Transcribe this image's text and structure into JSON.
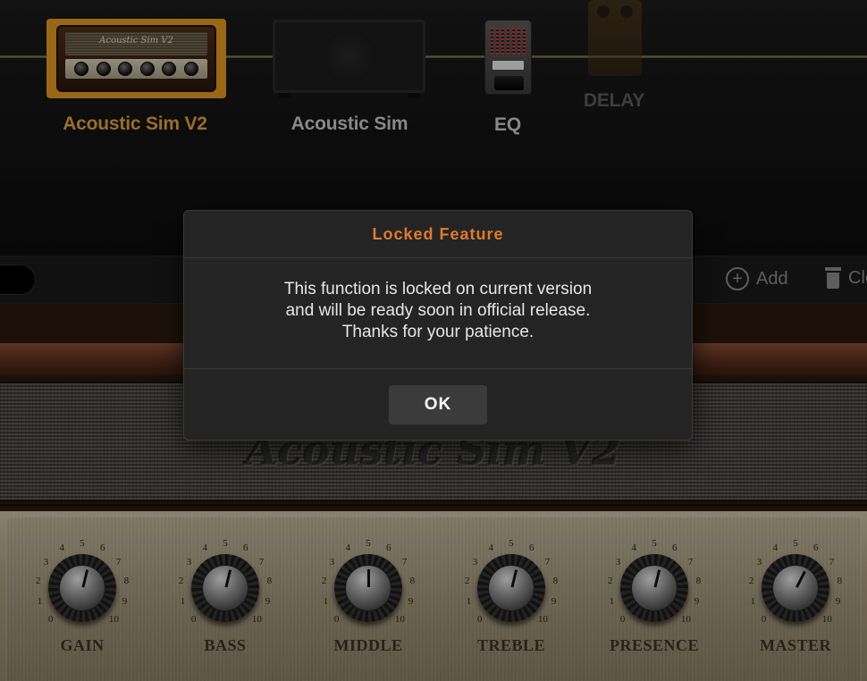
{
  "chain": {
    "items": [
      {
        "label": "Acoustic Sim V2",
        "thumb_text": "Acoustic Sim V2",
        "color": "#e3a33a"
      },
      {
        "label": "Acoustic Sim",
        "color": "#c9c9c9"
      },
      {
        "label": "EQ",
        "color": "#c9c9c9"
      },
      {
        "label": "DELAY",
        "color": "#5a5a5a"
      }
    ]
  },
  "toolbar": {
    "add_label": "Add",
    "clear_label": "Cle"
  },
  "amp": {
    "name": "Acoustic Sim V2",
    "knobs": [
      {
        "label": "GAIN",
        "value": 5.5
      },
      {
        "label": "BASS",
        "value": 5.5
      },
      {
        "label": "MIDDLE",
        "value": 5
      },
      {
        "label": "TREBLE",
        "value": 5.5
      },
      {
        "label": "PRESENCE",
        "value": 5.5
      },
      {
        "label": "MASTER",
        "value": 6
      }
    ],
    "scale": [
      "0",
      "1",
      "2",
      "3",
      "4",
      "5",
      "6",
      "7",
      "8",
      "9",
      "10"
    ]
  },
  "modal": {
    "title": "Locked Feature",
    "lines": [
      "This function is locked on current version",
      "and will be ready soon in official release.",
      "Thanks for your patience."
    ],
    "ok_label": "OK"
  },
  "colors": {
    "accent": "#e07a2a",
    "selected_frame": "#e39a1e"
  }
}
